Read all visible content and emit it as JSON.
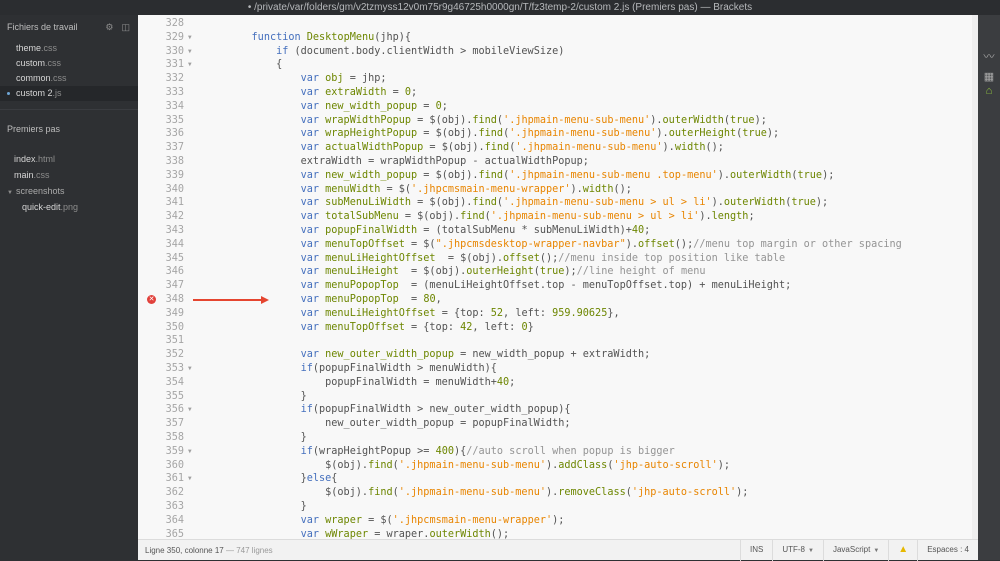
{
  "window": {
    "title": "• /private/var/folders/gm/v2tzmyss12v0m75r9g46725h0000gn/T/fz3temp-2/custom 2.js (Premiers pas) — Brackets"
  },
  "sidebar": {
    "working_files_label": "Fichiers de travail",
    "working_files": [
      {
        "name": "theme",
        "ext": ".css",
        "active": false
      },
      {
        "name": "custom",
        "ext": ".css",
        "active": false
      },
      {
        "name": "common",
        "ext": ".css",
        "active": false
      },
      {
        "name": "custom 2",
        "ext": ".js",
        "active": true
      }
    ],
    "project_label": "Premiers pas",
    "project_files": [
      {
        "name": "index",
        "ext": ".html",
        "type": "file",
        "indent": 14
      },
      {
        "name": "main",
        "ext": ".css",
        "type": "file",
        "indent": 14
      },
      {
        "name": "screenshots",
        "ext": "",
        "type": "folder",
        "indent": 7
      },
      {
        "name": "quick-edit",
        "ext": ".png",
        "type": "file",
        "indent": 22
      }
    ]
  },
  "editor": {
    "first_line": 328,
    "error_line": 348,
    "fold_lines": [
      329,
      330,
      331,
      353,
      356,
      359,
      361
    ],
    "lines": [
      "",
      "    <k>function</k> <f>DesktopMenu</f>(jhp){",
      "        <k>if</k> (document.body.clientWidth > mobileViewSize)",
      "        {",
      "            <k>var</k> <p>obj</p> = jhp;",
      "            <k>var</k> <p>extraWidth</p> = <n>0</n>;",
      "            <k>var</k> <p>new_width_popup</p> = <n>0</n>;",
      "            <k>var</k> <p>wrapWidthPopup</p> = $(obj).<f>find</f>(<s>'.jhpmain-menu-sub-menu'</s>).<f>outerWidth</f>(<n>true</n>);",
      "            <k>var</k> <p>wrapHeightPopup</p> = $(obj).<f>find</f>(<s>'.jhpmain-menu-sub-menu'</s>).<f>outerHeight</f>(<n>true</n>);",
      "            <k>var</k> <p>actualWidthPopup</p> = $(obj).<f>find</f>(<s>'.jhpmain-menu-sub-menu'</s>).<f>width</f>();",
      "            extraWidth = wrapWidthPopup - actualWidthPopup;",
      "            <k>var</k> <p>new_width_popup</p> = $(obj).<f>find</f>(<s>'.jhpmain-menu-sub-menu .top-menu'</s>).<f>outerWidth</f>(<n>true</n>);",
      "            <k>var</k> <p>menuWidth</p> = $(<s>'.jhpcmsmain-menu-wrapper'</s>).<f>width</f>();",
      "            <k>var</k> <p>subMenuLiWidth</p> = $(obj).<f>find</f>(<s>'.jhpmain-menu-sub-menu > ul > li'</s>).<f>outerWidth</f>(<n>true</n>);",
      "            <k>var</k> <p>totalSubMenu</p> = $(obj).<f>find</f>(<s>'.jhpmain-menu-sub-menu > ul > li'</s>).<f>length</f>;",
      "            <k>var</k> <p>popupFinalWidth</p> = (totalSubMenu * subMenuLiWidth)+<n>40</n>;",
      "            <k>var</k> <p>menuTopOffset</p> = $(<s>\".jhpcmsdesktop-wrapper-navbar\"</s>).<f>offset</f>();<c>//menu top margin or other spacing</c>",
      "            <k>var</k> <p>menuLiHeightOffset</p>  = $(obj).<f>offset</f>();<c>//menu inside top position like table</c>",
      "            <k>var</k> <p>menuLiHeight</p>  = $(obj).<f>outerHeight</f>(<n>true</n>);<c>//line height of menu</c>",
      "            <k>var</k> <p>menuPopopTop</p>  = (menuLiHeightOffset.top - menuTopOffset.top) + menuLiHeight;",
      "            <k>var</k> <p>menuPopopTop</p>  = <n>80</n>,",
      "            <k>var</k> <p>menuLiHeightOffset</p> = {top: <n>52</n>, left: <n>959.90625</n>},",
      "            <k>var</k> <p>menuTopOffset</p> = {top: <n>42</n>, left: <n>0</n>}",
      "",
      "            <k>var</k> <p>new_outer_width_popup</p> = new_width_popup + extraWidth;",
      "            <k>if</k>(popupFinalWidth > menuWidth){",
      "                popupFinalWidth = menuWidth+<n>40</n>;",
      "            }",
      "            <k>if</k>(popupFinalWidth > new_outer_width_popup){",
      "                new_outer_width_popup = popupFinalWidth;",
      "            }",
      "            <k>if</k>(wrapHeightPopup >= <n>400</n>){<c>//auto scroll when popup is bigger</c>",
      "                $(obj).<f>find</f>(<s>'.jhpmain-menu-sub-menu'</s>).<f>addClass</f>(<s>'jhp-auto-scroll'</s>);",
      "            }<k>else</k>{",
      "                $(obj).<f>find</f>(<s>'.jhpmain-menu-sub-menu'</s>).<f>removeClass</f>(<s>'jhp-auto-scroll'</s>);",
      "            }",
      "            <k>var</k> <p>wraper</p> = $(<s>'.jhpcmsmain-menu-wrapper'</s>);",
      "            <k>var</k> <p>wWraper</p> = wraper.<f>outerWidth</f>();"
    ]
  },
  "statusbar": {
    "position": "Ligne 350, colonne 17",
    "line_count": "— 747 lignes",
    "ins": "INS",
    "encoding": "UTF-8",
    "language": "JavaScript",
    "spaces": "Espaces : 4"
  },
  "icons": {
    "settings": "gear-icon",
    "split": "split-view-icon",
    "live_preview": "live-preview-icon",
    "extensions": "extension-manager-icon",
    "git": "git-icon",
    "error": "error-icon",
    "warning": "warning-icon"
  },
  "colors": {
    "keyword": "#446fbd",
    "string": "#e88501",
    "number": "#6d8600",
    "comment": "#949494",
    "error_marker": "#e1413b",
    "arrow": "#e5452f"
  }
}
